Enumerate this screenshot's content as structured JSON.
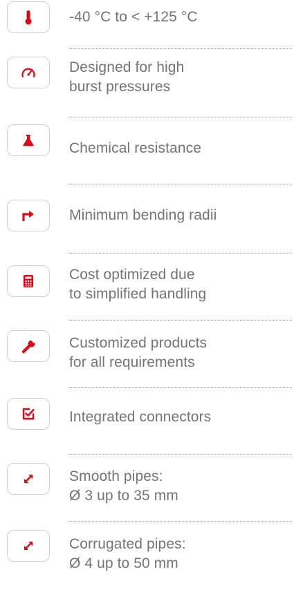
{
  "colors": {
    "accent": "#e30613",
    "text": "#747474",
    "icon_border": "#cfcfcf",
    "separator": "#9a9a9a"
  },
  "features": [
    {
      "icon": "thermometer-icon",
      "lines": [
        "-40 °C to < +125 °C"
      ]
    },
    {
      "icon": "pressure-gauge-icon",
      "lines": [
        "Designed for high",
        "burst pressures"
      ]
    },
    {
      "icon": "chemical-flask-icon",
      "lines": [
        "Chemical resistance"
      ]
    },
    {
      "icon": "bend-arrow-icon",
      "lines": [
        "Minimum bending radii"
      ]
    },
    {
      "icon": "calculator-icon",
      "lines": [
        "Cost optimized due",
        "to simplified handling"
      ]
    },
    {
      "icon": "wrench-icon",
      "lines": [
        "Customized products",
        "for all requirements"
      ]
    },
    {
      "icon": "checkbox-icon",
      "lines": [
        "Integrated connectors"
      ]
    },
    {
      "icon": "diagonal-arrows-icon",
      "lines": [
        "Smooth pipes:",
        "Ø 3 up to 35 mm"
      ]
    },
    {
      "icon": "diagonal-arrows-icon",
      "lines": [
        "Corrugated pipes:",
        "Ø 4 up to 50 mm"
      ]
    }
  ]
}
